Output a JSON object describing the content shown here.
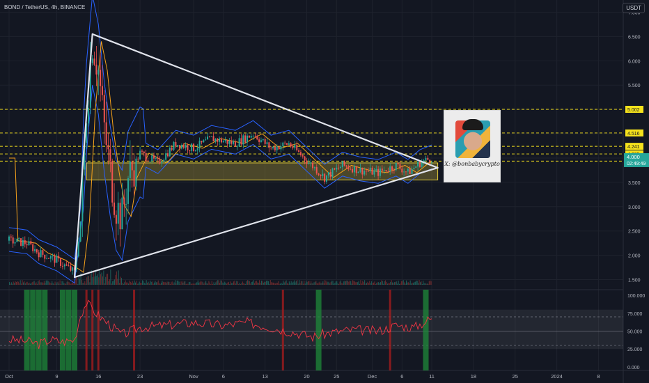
{
  "title": "BOND / TetherUS, 4h, BINANCE",
  "currency": "USDT",
  "photo_caption": "X: @bonbabycrypto",
  "colors": {
    "background": "#131722",
    "grid": "#1e222d",
    "axis_text": "#b2b5be",
    "up": "#26a69a",
    "down": "#ef5350",
    "zone": "#b5a13a",
    "triangle": "#e0e3eb",
    "bb": "#2962ff",
    "ma": "#f7a21b",
    "hline": "#f5e21c",
    "rsi": "#f23645"
  },
  "chart_data": [
    {
      "type": "candlestick",
      "symbol": "BOND/USDT",
      "interval": "4h",
      "ylim": [
        1.35,
        7.05
      ],
      "y_ticks": [
        "7.000",
        "6.500",
        "6.000",
        "5.500",
        "5.000",
        "4.500",
        "4.000",
        "3.500",
        "3.000",
        "2.500",
        "2.000",
        "1.500"
      ],
      "x_ticks": [
        "Oct",
        "9",
        "16",
        "23",
        "Nov",
        "6",
        "13",
        "20",
        "25",
        "Dec",
        "6",
        "11",
        "18",
        "25",
        "2024",
        "8"
      ],
      "x_tick_dates": [
        "2023-10-01",
        "2023-10-09",
        "2023-10-16",
        "2023-10-23",
        "2023-11-01",
        "2023-11-06",
        "2023-11-13",
        "2023-11-20",
        "2023-11-25",
        "2023-12-01",
        "2023-12-06",
        "2023-12-11",
        "2023-12-18",
        "2023-12-25",
        "2024-01-01",
        "2024-01-08"
      ],
      "price_path": [
        [
          "2023-10-01",
          2.3
        ],
        [
          "2023-10-04",
          2.25
        ],
        [
          "2023-10-06",
          2.05
        ],
        [
          "2023-10-09",
          1.9
        ],
        [
          "2023-10-12",
          1.65
        ],
        [
          "2023-10-13",
          2.7
        ],
        [
          "2023-10-14",
          5.0
        ],
        [
          "2023-10-15",
          6.4
        ],
        [
          "2023-10-16",
          5.8
        ],
        [
          "2023-10-17",
          4.6
        ],
        [
          "2023-10-18",
          3.7
        ],
        [
          "2023-10-19",
          3.0
        ],
        [
          "2023-10-20",
          2.8
        ],
        [
          "2023-10-21",
          3.6
        ],
        [
          "2023-10-23",
          4.1
        ],
        [
          "2023-10-26",
          3.9
        ],
        [
          "2023-10-29",
          4.3
        ],
        [
          "2023-11-01",
          4.2
        ],
        [
          "2023-11-04",
          4.4
        ],
        [
          "2023-11-08",
          4.3
        ],
        [
          "2023-11-11",
          4.5
        ],
        [
          "2023-11-14",
          4.2
        ],
        [
          "2023-11-17",
          4.3
        ],
        [
          "2023-11-20",
          3.95
        ],
        [
          "2023-11-23",
          3.6
        ],
        [
          "2023-11-26",
          3.85
        ],
        [
          "2023-11-29",
          3.75
        ],
        [
          "2023-12-02",
          3.7
        ],
        [
          "2023-12-05",
          3.85
        ],
        [
          "2023-12-07",
          3.7
        ],
        [
          "2023-12-09",
          3.9
        ],
        [
          "2023-12-11",
          4.0
        ]
      ],
      "triangle": [
        [
          "2023-10-15",
          6.55
        ],
        [
          "2023-12-12",
          3.8
        ],
        [
          "2023-10-12",
          1.55
        ]
      ],
      "zone": {
        "start": "2023-10-14",
        "end": "2023-12-12",
        "low": 3.55,
        "high": 3.9
      },
      "price_lines": [
        {
          "value": 5.002,
          "label": "5.002"
        },
        {
          "value": 4.516,
          "label": "4.516"
        },
        {
          "value": 4.241,
          "label": "4.241"
        },
        {
          "value": 4.085,
          "label": "4.085"
        },
        {
          "value": 3.937,
          "label": "3.937"
        }
      ],
      "last_price": {
        "value": 4.0,
        "label": "4.000",
        "countdown": "02:49:49"
      }
    },
    {
      "type": "line",
      "name": "RSI",
      "ylim": [
        -5,
        108
      ],
      "y_ticks": [
        "100.000",
        "75.000",
        "50.000",
        "25.000",
        "0.000"
      ],
      "levels": [
        70,
        50,
        30
      ],
      "band": [
        25,
        80
      ],
      "values_path": [
        [
          "2023-10-01",
          38
        ],
        [
          "2023-10-04",
          36
        ],
        [
          "2023-10-06",
          32
        ],
        [
          "2023-10-08",
          38
        ],
        [
          "2023-10-10",
          35
        ],
        [
          "2023-10-12",
          38
        ],
        [
          "2023-10-13",
          72
        ],
        [
          "2023-10-14",
          90
        ],
        [
          "2023-10-16",
          72
        ],
        [
          "2023-10-18",
          58
        ],
        [
          "2023-10-20",
          45
        ],
        [
          "2023-10-23",
          55
        ],
        [
          "2023-10-27",
          58
        ],
        [
          "2023-11-01",
          62
        ],
        [
          "2023-11-06",
          58
        ],
        [
          "2023-11-10",
          62
        ],
        [
          "2023-11-14",
          55
        ],
        [
          "2023-11-18",
          48
        ],
        [
          "2023-11-21",
          42
        ],
        [
          "2023-11-24",
          48
        ],
        [
          "2023-11-28",
          52
        ],
        [
          "2023-12-02",
          50
        ],
        [
          "2023-12-05",
          58
        ],
        [
          "2023-12-08",
          55
        ],
        [
          "2023-12-11",
          68
        ]
      ],
      "green_bars": [
        "2023-10-04",
        "2023-10-05",
        "2023-10-06",
        "2023-10-07",
        "2023-10-10",
        "2023-10-11",
        "2023-10-12",
        "2023-11-22",
        "2023-12-10"
      ],
      "red_bars": [
        "2023-10-14",
        "2023-10-15",
        "2023-10-16",
        "2023-10-22",
        "2023-11-16",
        "2023-12-04"
      ]
    }
  ]
}
